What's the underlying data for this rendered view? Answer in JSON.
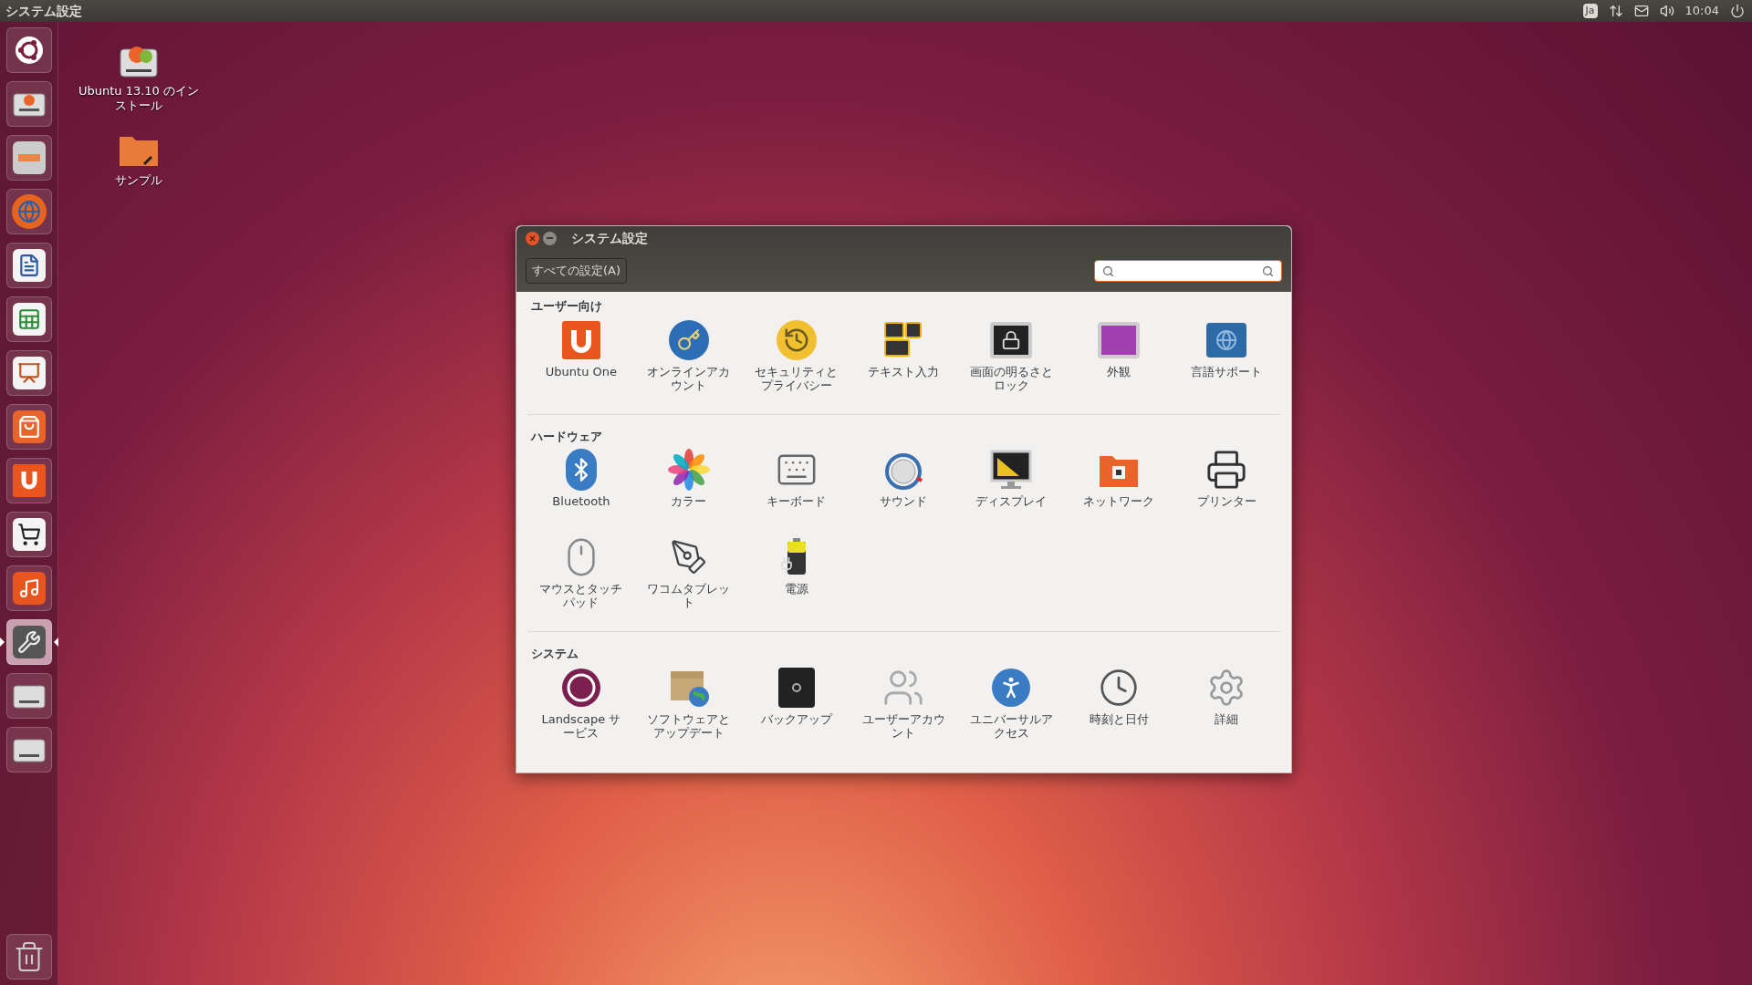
{
  "top_panel": {
    "title": "システム設定",
    "keyboard_layout": "Ja",
    "clock": "10:04"
  },
  "launcher": [
    {
      "kind": "dash",
      "active": false
    },
    {
      "kind": "installer",
      "active": false
    },
    {
      "kind": "files",
      "active": false
    },
    {
      "kind": "browser",
      "active": false
    },
    {
      "kind": "writer",
      "active": false
    },
    {
      "kind": "calc",
      "active": false
    },
    {
      "kind": "impress",
      "active": false
    },
    {
      "kind": "software",
      "active": false
    },
    {
      "kind": "cloud",
      "active": false
    },
    {
      "kind": "shop",
      "active": false
    },
    {
      "kind": "music",
      "active": false
    },
    {
      "kind": "settings",
      "active": true
    },
    {
      "kind": "drive",
      "active": false
    },
    {
      "kind": "drive",
      "active": false
    }
  ],
  "trash": {
    "kind": "trash"
  },
  "desktop_icons": [
    {
      "label": "Ubuntu 13.10 のインストール",
      "kind": "installer"
    },
    {
      "label": "サンプル",
      "kind": "folder"
    }
  ],
  "window": {
    "title": "システム設定",
    "all_settings_button": "すべての設定(A)",
    "sections": [
      {
        "title": "ユーザー向け",
        "items": [
          {
            "label": "Ubuntu One",
            "kind": "ubuntu-one"
          },
          {
            "label": "オンラインアカウント",
            "kind": "online-accounts"
          },
          {
            "label": "セキュリティとプライバシー",
            "kind": "security"
          },
          {
            "label": "テキスト入力",
            "kind": "text-input"
          },
          {
            "label": "画面の明るさとロック",
            "kind": "brightness"
          },
          {
            "label": "外観",
            "kind": "appearance"
          },
          {
            "label": "言語サポート",
            "kind": "language"
          }
        ]
      },
      {
        "title": "ハードウェア",
        "items": [
          {
            "label": "Bluetooth",
            "kind": "bluetooth"
          },
          {
            "label": "カラー",
            "kind": "color"
          },
          {
            "label": "キーボード",
            "kind": "keyboard"
          },
          {
            "label": "サウンド",
            "kind": "sound"
          },
          {
            "label": "ディスプレイ",
            "kind": "display"
          },
          {
            "label": "ネットワーク",
            "kind": "network"
          },
          {
            "label": "プリンター",
            "kind": "printer"
          },
          {
            "label": "マウスとタッチパッド",
            "kind": "mouse"
          },
          {
            "label": "ワコムタブレット",
            "kind": "wacom"
          },
          {
            "label": "電源",
            "kind": "power"
          }
        ]
      },
      {
        "title": "システム",
        "items": [
          {
            "label": "Landscape サービス",
            "kind": "landscape"
          },
          {
            "label": "ソフトウェアとアップデート",
            "kind": "software"
          },
          {
            "label": "バックアップ",
            "kind": "backup"
          },
          {
            "label": "ユーザーアカウント",
            "kind": "users"
          },
          {
            "label": "ユニバーサルアクセス",
            "kind": "access"
          },
          {
            "label": "時刻と日付",
            "kind": "datetime"
          },
          {
            "label": "詳細",
            "kind": "details"
          }
        ]
      }
    ]
  }
}
